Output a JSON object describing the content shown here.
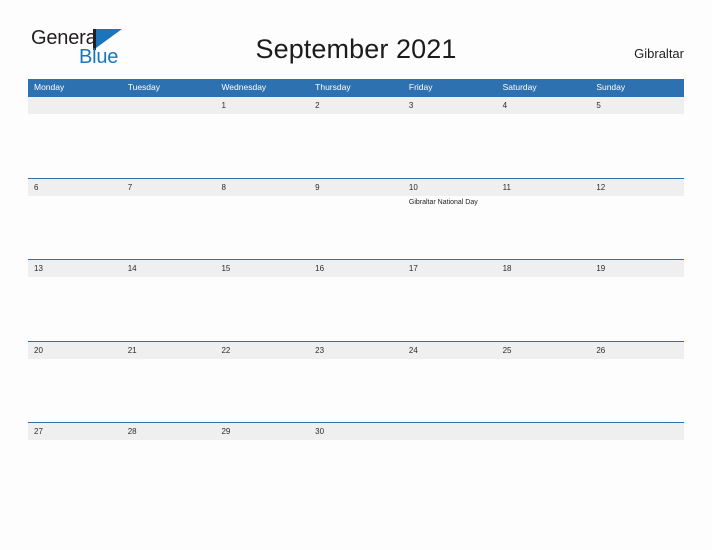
{
  "brand": {
    "name_part1": "General",
    "name_part2": "Blue",
    "logo_icon": "blue-flag-triangle"
  },
  "header": {
    "title": "September 2021",
    "country": "Gibraltar"
  },
  "calendar": {
    "weekday_headers": [
      "Monday",
      "Tuesday",
      "Wednesday",
      "Thursday",
      "Friday",
      "Saturday",
      "Sunday"
    ],
    "header_color": "#2e71b0",
    "date_band_color": "#efefef",
    "weeks": [
      {
        "days": [
          {
            "num": "",
            "event": ""
          },
          {
            "num": "",
            "event": ""
          },
          {
            "num": "1",
            "event": ""
          },
          {
            "num": "2",
            "event": ""
          },
          {
            "num": "3",
            "event": ""
          },
          {
            "num": "4",
            "event": ""
          },
          {
            "num": "5",
            "event": ""
          }
        ]
      },
      {
        "days": [
          {
            "num": "6",
            "event": ""
          },
          {
            "num": "7",
            "event": ""
          },
          {
            "num": "8",
            "event": ""
          },
          {
            "num": "9",
            "event": ""
          },
          {
            "num": "10",
            "event": "Gibraltar National Day"
          },
          {
            "num": "11",
            "event": ""
          },
          {
            "num": "12",
            "event": ""
          }
        ]
      },
      {
        "days": [
          {
            "num": "13",
            "event": ""
          },
          {
            "num": "14",
            "event": ""
          },
          {
            "num": "15",
            "event": ""
          },
          {
            "num": "16",
            "event": ""
          },
          {
            "num": "17",
            "event": ""
          },
          {
            "num": "18",
            "event": ""
          },
          {
            "num": "19",
            "event": ""
          }
        ]
      },
      {
        "days": [
          {
            "num": "20",
            "event": ""
          },
          {
            "num": "21",
            "event": ""
          },
          {
            "num": "22",
            "event": ""
          },
          {
            "num": "23",
            "event": ""
          },
          {
            "num": "24",
            "event": ""
          },
          {
            "num": "25",
            "event": ""
          },
          {
            "num": "26",
            "event": ""
          }
        ]
      },
      {
        "days": [
          {
            "num": "27",
            "event": ""
          },
          {
            "num": "28",
            "event": ""
          },
          {
            "num": "29",
            "event": ""
          },
          {
            "num": "30",
            "event": ""
          },
          {
            "num": "",
            "event": ""
          },
          {
            "num": "",
            "event": ""
          },
          {
            "num": "",
            "event": ""
          }
        ]
      }
    ]
  }
}
